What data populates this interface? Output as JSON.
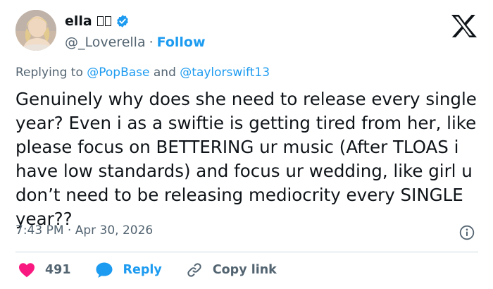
{
  "author": {
    "display_name": "ella",
    "handle": "@_Loverella",
    "separator": "·",
    "follow_label": "Follow"
  },
  "reply_context": {
    "prefix": "Replying to",
    "mention_1": "@PopBase",
    "conjunction": "and",
    "mention_2": "@taylorswift13"
  },
  "tweet": {
    "text": "Genuinely why does she need to release every single year? Even i as a swiftie is getting tired from her, like please focus on BETTERING ur music (After TLOAS i have low standards) and focus ur wedding, like girl u don’t need to be releasing mediocrity every SINGLE year??"
  },
  "meta": {
    "time": "7:43 PM",
    "separator": "·",
    "date": "Apr 30, 2026"
  },
  "actions": {
    "like_count": "491",
    "reply_label": "Reply",
    "copy_label": "Copy link"
  },
  "colors": {
    "accent": "#1d9bf0",
    "like": "#f91880",
    "muted": "#536471",
    "text": "#0f1419"
  },
  "icons": [
    "verified-badge-icon",
    "x-logo-icon",
    "info-icon",
    "heart-icon",
    "reply-bubble-icon",
    "link-icon"
  ]
}
